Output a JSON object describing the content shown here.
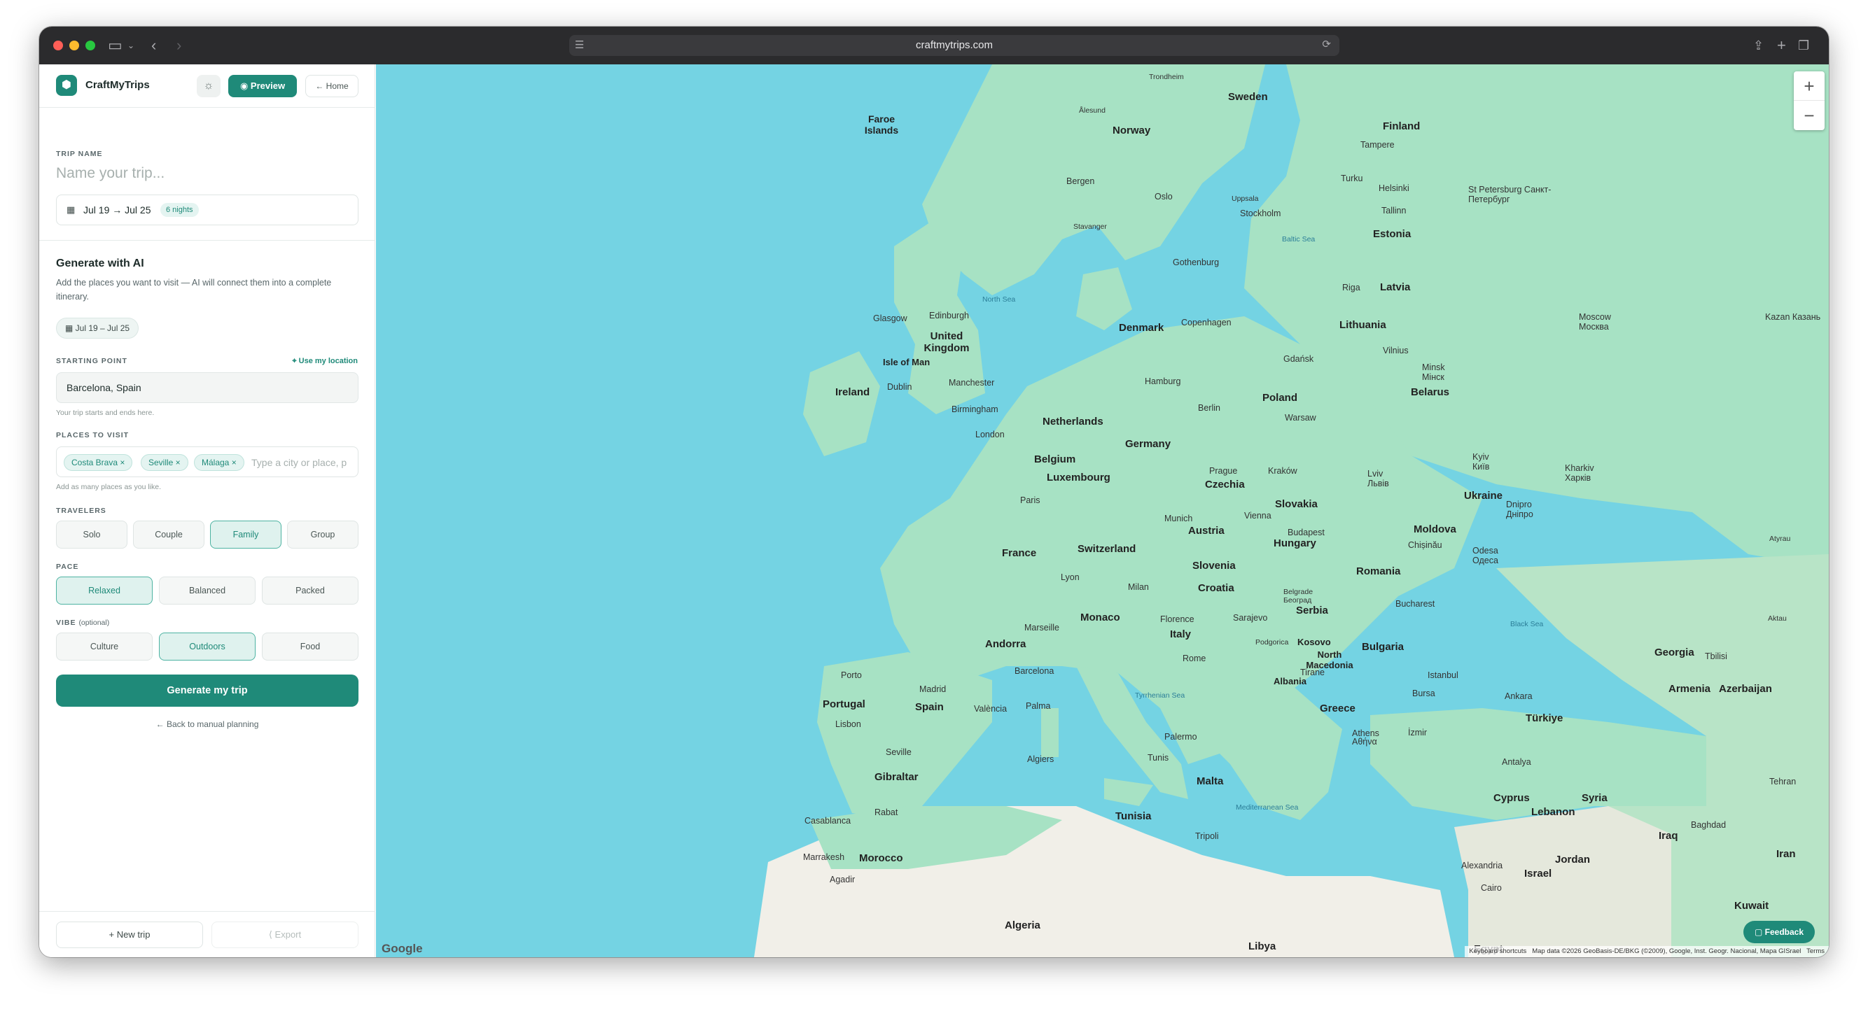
{
  "browser": {
    "url": "craftmytrips.com"
  },
  "app": {
    "brand": "CraftMyTrips",
    "preview_label": "Preview",
    "home_label": "Home"
  },
  "trip": {
    "name_label": "TRIP NAME",
    "name_placeholder": "Name your trip...",
    "dates": "Jul 19 → Jul 25",
    "nights": "6 nights"
  },
  "generate": {
    "title": "Generate with AI",
    "description": "Add the places you want to visit — AI will connect them into a complete itinerary.",
    "date_pill": "Jul 19 – Jul 25",
    "starting_label": "STARTING POINT",
    "use_location": "Use my location",
    "starting_value": "Barcelona, Spain",
    "starting_hint": "Your trip starts and ends here.",
    "places_label": "PLACES TO VISIT",
    "places": [
      "Costa Brava ×",
      "Seville ×",
      "Málaga ×"
    ],
    "places_placeholder": "Type a city or place, p",
    "places_hint": "Add as many places as you like.",
    "travelers_label": "TRAVELERS",
    "travelers": [
      "Solo",
      "Couple",
      "Family",
      "Group"
    ],
    "travelers_selected": "Family",
    "pace_label": "PACE",
    "pace": [
      "Relaxed",
      "Balanced",
      "Packed"
    ],
    "pace_selected": "Relaxed",
    "vibe_label": "VIBE",
    "vibe_optional": "(optional)",
    "vibe": [
      "Culture",
      "Outdoors",
      "Food"
    ],
    "vibe_selected": "Outdoors",
    "button": "Generate my trip",
    "back_link": "← Back to manual planning"
  },
  "footer": {
    "new_trip": "+  New trip",
    "export": "Export"
  },
  "map": {
    "countries": [
      "Sweden",
      "Norway",
      "Finland",
      "Faroe Islands",
      "Estonia",
      "Latvia",
      "Lithuania",
      "Denmark",
      "United Kingdom",
      "Isle of Man",
      "Ireland",
      "Netherlands",
      "Germany",
      "Poland",
      "Belarus",
      "Belgium",
      "Luxembourg",
      "Czechia",
      "Slovakia",
      "Ukraine",
      "France",
      "Switzerland",
      "Austria",
      "Hungary",
      "Moldova",
      "Slovenia",
      "Croatia",
      "Romania",
      "Serbia",
      "Monaco",
      "Andorra",
      "Italy",
      "Bulgaria",
      "Kosovo",
      "North Macedonia",
      "Albania",
      "Portugal",
      "Spain",
      "Greece",
      "Türkiye",
      "Georgia",
      "Armenia",
      "Azerbaijan",
      "Gibraltar",
      "Malta",
      "Tunisia",
      "Morocco",
      "Algeria",
      "Libya",
      "Egypt",
      "Cyprus",
      "Syria",
      "Lebanon",
      "Israel",
      "Jordan",
      "Iraq",
      "Iran",
      "Kuwait"
    ],
    "cities": [
      "Trondheim",
      "Ålesund",
      "Bergen",
      "Oslo",
      "Stavanger",
      "Uppsala",
      "Stockholm",
      "Gothenburg",
      "Tampere",
      "Helsinki",
      "Turku",
      "Tallinn",
      "St Petersburg Санкт-Петербург",
      "Riga",
      "Copenhagen",
      "Vilnius",
      "Minsk Мінск",
      "Moscow Москва",
      "Kazan Казань",
      "Glasgow",
      "Edinburgh",
      "Dublin",
      "Manchester",
      "Birmingham",
      "London",
      "Hamburg",
      "Gdańsk",
      "Berlin",
      "Warsaw",
      "Prague",
      "Kraków",
      "Lviv Львів",
      "Kyiv Київ",
      "Kharkiv Харків",
      "Paris",
      "Munich",
      "Vienna",
      "Budapest",
      "Dnipro Дніпро",
      "Odesa Одеса",
      "Chișinău",
      "Lyon",
      "Milan",
      "Marseille",
      "Florence",
      "Sarajevo",
      "Belgrade Београд",
      "Bucharest",
      "Rome",
      "Podgorica",
      "Tirane",
      "Barcelona",
      "Porto",
      "Madrid",
      "Lisbon",
      "València",
      "Palma",
      "Seville",
      "Istanbul",
      "Bursa",
      "Ankara",
      "Tbilisi",
      "İzmir",
      "Athens Αθήνα",
      "Antalya",
      "Palermo",
      "Algiers",
      "Tunis",
      "Tripoli",
      "Casablanca",
      "Rabat",
      "Marrakesh",
      "Agadir",
      "Alexandria",
      "Cairo",
      "Baghdad",
      "Tehran",
      "Atyrau",
      "Aktau"
    ],
    "seas": [
      "North Sea",
      "Baltic Sea",
      "Black Sea",
      "Tyrrhenian Sea",
      "Mediterranean Sea"
    ],
    "zoom_in": "+",
    "zoom_out": "−",
    "google": "Google",
    "keyboard": "Keyboard shortcuts",
    "attribution": "Map data ©2026 GeoBasis-DE/BKG (©2009), Google, Inst. Geogr. Nacional, Mapa GISrael",
    "terms": "Terms",
    "feedback": "Feedback"
  },
  "colors": {
    "accent": "#1f8a79",
    "water": "#74d3e3",
    "land": "#a7e2c4",
    "desert": "#f1efe8"
  }
}
